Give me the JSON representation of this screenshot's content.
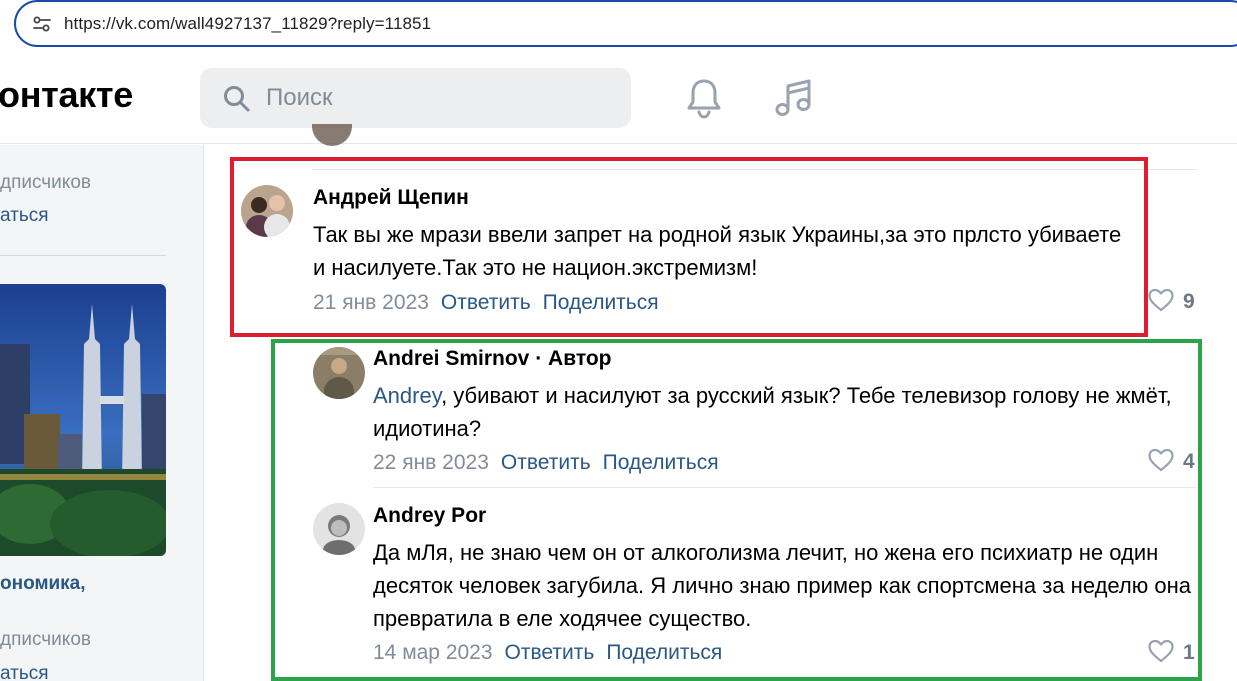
{
  "browser": {
    "url": "https://vk.com/wall4927137_11829?reply=11851"
  },
  "header": {
    "logo_text": "онтакте",
    "search_placeholder": "Поиск"
  },
  "left_column": {
    "group1_subscribers": "дписчиков",
    "group1_action": "аться",
    "group2_title": "ономика,",
    "group2_subscribers": "дписчиков",
    "group2_action": "аться"
  },
  "comments": [
    {
      "author": "Андрей Щепин",
      "text": "Так вы же мрази ввели запрет на родной язык Украины,за это прлсто убиваете и насилуете.Так это не национ.экстремизм!",
      "date": "21 янв 2023",
      "reply_label": "Ответить",
      "share_label": "Поделиться",
      "likes": "9"
    }
  ],
  "replies": [
    {
      "author": "Andrei Smirnov",
      "author_badge": " · Автор",
      "mention": "Andrey",
      "text": ", убивают и насилуют за русский язык? Тебе телевизор голову не жмёт, идиотина?",
      "date": "22 янв 2023",
      "reply_label": "Ответить",
      "share_label": "Поделиться",
      "likes": "4"
    },
    {
      "author": "Andrey Por",
      "text": "Да мЛя, не знаю чем он от алкоголизма лечит, но жена его психиатр не один десяток человек загубила. Я лично знаю пример как спортсмена за неделю она превратила в еле ходячее существо.",
      "date": "14 мар 2023",
      "reply_label": "Ответить",
      "share_label": "Поделиться",
      "likes": "1"
    }
  ],
  "colors": {
    "accent_link": "#2a5885",
    "secondary_text": "#818c99",
    "highlight_red": "#dd1e2e",
    "highlight_green": "#2ba348",
    "urlbar_border": "#1a4aa8"
  }
}
